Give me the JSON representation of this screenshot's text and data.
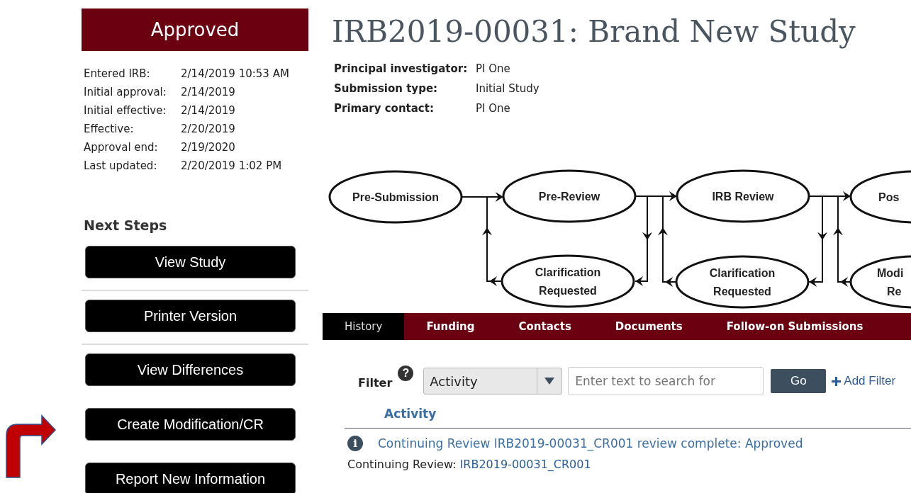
{
  "status_banner": "Approved",
  "dates": [
    {
      "label": "Entered IRB:",
      "value": "2/14/2019 10:53 AM"
    },
    {
      "label": "Initial approval:",
      "value": "2/14/2019"
    },
    {
      "label": "Initial effective:",
      "value": "2/14/2019"
    },
    {
      "label": "Effective:",
      "value": "2/20/2019"
    },
    {
      "label": "Approval end:",
      "value": "2/19/2020"
    },
    {
      "label": "Last updated:",
      "value": "2/20/2019 1:02 PM"
    }
  ],
  "next_steps": {
    "title": "Next Steps",
    "buttons": [
      {
        "label": "View Study",
        "divider_before": false
      },
      {
        "label": "Printer Version",
        "divider_before": true
      },
      {
        "label": "View Differences",
        "divider_before": true
      },
      {
        "label": "Create Modification/CR",
        "divider_before": false
      },
      {
        "label": "Report New Information",
        "divider_before": false
      }
    ]
  },
  "title": "IRB2019-00031: Brand New Study",
  "details": [
    {
      "label": "Principal investigator:",
      "value": "PI One"
    },
    {
      "label": "Submission type:",
      "value": "Initial Study"
    },
    {
      "label": "Primary contact:",
      "value": "PI One"
    }
  ],
  "workflow": {
    "nodes": [
      {
        "lines": [
          "Pre-Submission"
        ]
      },
      {
        "lines": [
          "Pre-Review"
        ]
      },
      {
        "lines": [
          "IRB Review"
        ]
      },
      {
        "lines": [
          "Pos"
        ]
      },
      {
        "lines": [
          "Clarification",
          "Requested"
        ]
      },
      {
        "lines": [
          "Clarification",
          "Requested"
        ]
      },
      {
        "lines": [
          "Modi",
          "Re"
        ]
      }
    ]
  },
  "tabs": [
    {
      "label": "History",
      "selected": true
    },
    {
      "label": "Funding",
      "selected": false
    },
    {
      "label": "Contacts",
      "selected": false
    },
    {
      "label": "Documents",
      "selected": false
    },
    {
      "label": "Follow-on Submissions",
      "selected": false
    }
  ],
  "filter": {
    "label": "Filter",
    "help": "?",
    "dropdown": "Activity",
    "search_placeholder": "Enter text to search for",
    "go": "Go",
    "add_filter": "Add Filter"
  },
  "activity": {
    "column": "Activity",
    "entries": [
      {
        "icon": "i",
        "title": "Continuing Review IRB2019-00031_CR001 review complete: Approved",
        "detail_label": "Continuing Review:",
        "detail_link": "IRB2019-00031_CR001"
      }
    ]
  }
}
